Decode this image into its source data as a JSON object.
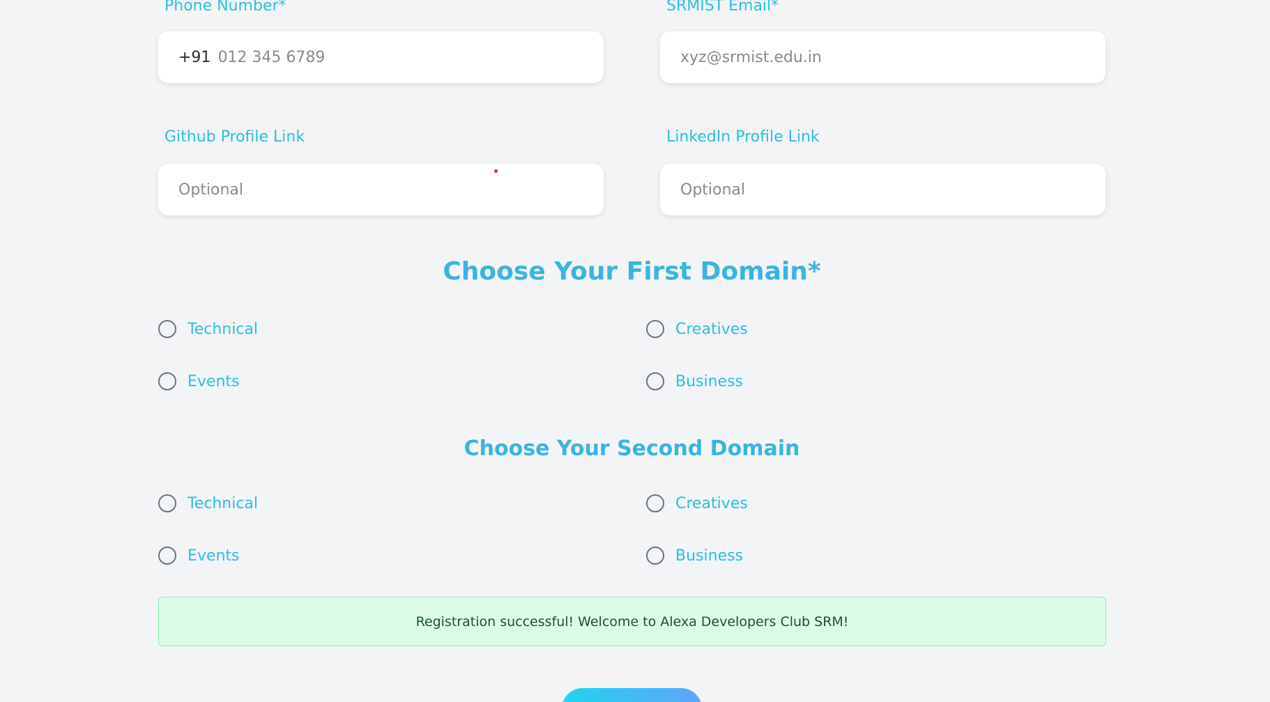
{
  "contact": {
    "phone_label": "Phone Number*",
    "phone_prefix": "+91",
    "phone_placeholder": "012 345 6789",
    "email_label": "SRMIST Email*",
    "email_placeholder": "xyz@srmist.edu.in"
  },
  "profiles": {
    "github_label": "Github Profile Link",
    "github_placeholder": "Optional",
    "linkedin_label": "LinkedIn Profile Link",
    "linkedin_placeholder": "Optional"
  },
  "first_domain": {
    "title": "Choose Your First Domain*",
    "options": [
      "Technical",
      "Creatives",
      "Events",
      "Business"
    ]
  },
  "second_domain": {
    "title": "Choose Your Second Domain",
    "options": [
      "Technical",
      "Creatives",
      "Events",
      "Business"
    ]
  },
  "status": {
    "message": "Registration successful! Welcome to Alexa Developers Club SRM!"
  },
  "colors": {
    "accent": "#2bbfe0",
    "heading": "#3bb3e2",
    "success_bg": "#dcfce7",
    "success_border": "#86efac",
    "success_text": "#1f5130",
    "background": "#f3f4f6"
  }
}
